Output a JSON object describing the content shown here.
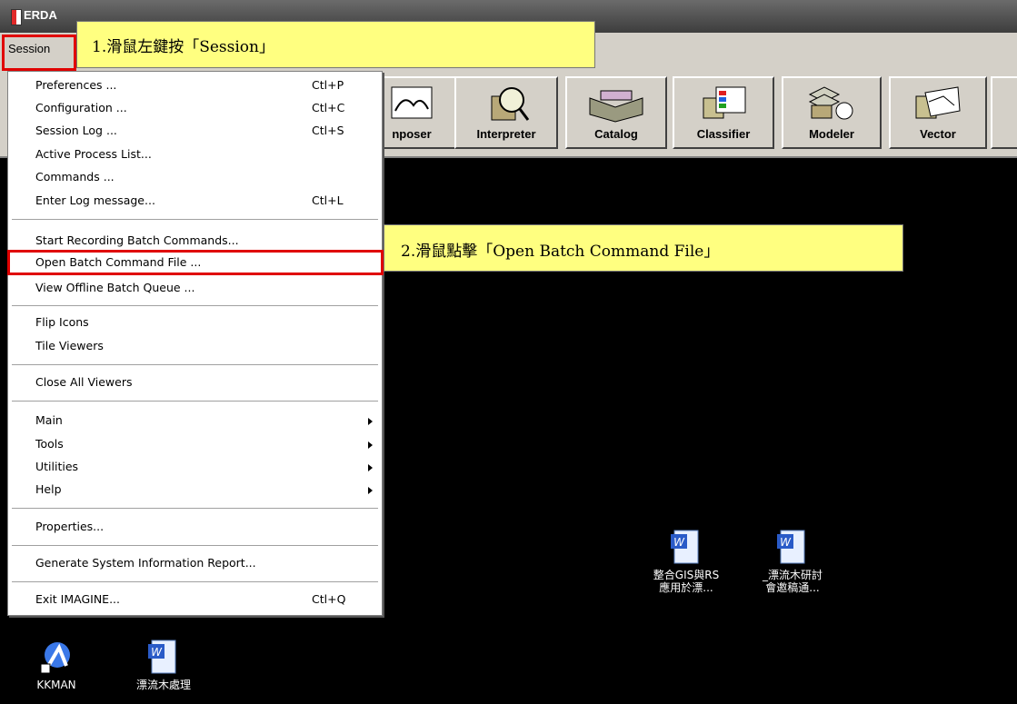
{
  "window": {
    "title": "ERDA"
  },
  "menubar": {
    "session": "Session"
  },
  "toolbar": {
    "buttons": [
      {
        "label": "nposer"
      },
      {
        "label": "Interpreter"
      },
      {
        "label": "Catalog"
      },
      {
        "label": "Classifier"
      },
      {
        "label": "Modeler"
      },
      {
        "label": "Vector"
      }
    ]
  },
  "session_menu": {
    "items": [
      {
        "label": "Preferences ...",
        "shortcut": "Ctl+P"
      },
      {
        "label": "Configuration ...",
        "shortcut": "Ctl+C"
      },
      {
        "label": "Session Log ...",
        "shortcut": "Ctl+S"
      },
      {
        "label": "Active Process List..."
      },
      {
        "label": "Commands ..."
      },
      {
        "label": "Enter Log message...",
        "shortcut": "Ctl+L"
      },
      {
        "label": "Start Recording Batch Commands..."
      },
      {
        "label": "Open Batch Command File ..."
      },
      {
        "label": "View Offline Batch Queue ..."
      },
      {
        "label": "Flip Icons"
      },
      {
        "label": "Tile Viewers"
      },
      {
        "label": "Close All Viewers"
      },
      {
        "label": "Main"
      },
      {
        "label": "Tools"
      },
      {
        "label": "Utilities"
      },
      {
        "label": "Help"
      },
      {
        "label": "Properties..."
      },
      {
        "label": "Generate System Information Report..."
      },
      {
        "label": "Exit IMAGINE...",
        "shortcut": "Ctl+Q"
      }
    ]
  },
  "callouts": {
    "step1": "1.滑鼠左鍵按「Session」",
    "step2": "2.滑鼠點擊「Open Batch Command File」"
  },
  "desktop": {
    "icons": [
      {
        "line1": "整合GIS與RS",
        "line2": "應用於漂..."
      },
      {
        "line1": "_漂流木研討",
        "line2": "會邀稿通..."
      },
      {
        "line1": "KKMAN"
      },
      {
        "line1": "漂流木處理"
      }
    ]
  },
  "colors": {
    "highlight": "#e00000",
    "callout_bg": "#ffff80",
    "toolbar_bg": "#d4d0c8"
  }
}
